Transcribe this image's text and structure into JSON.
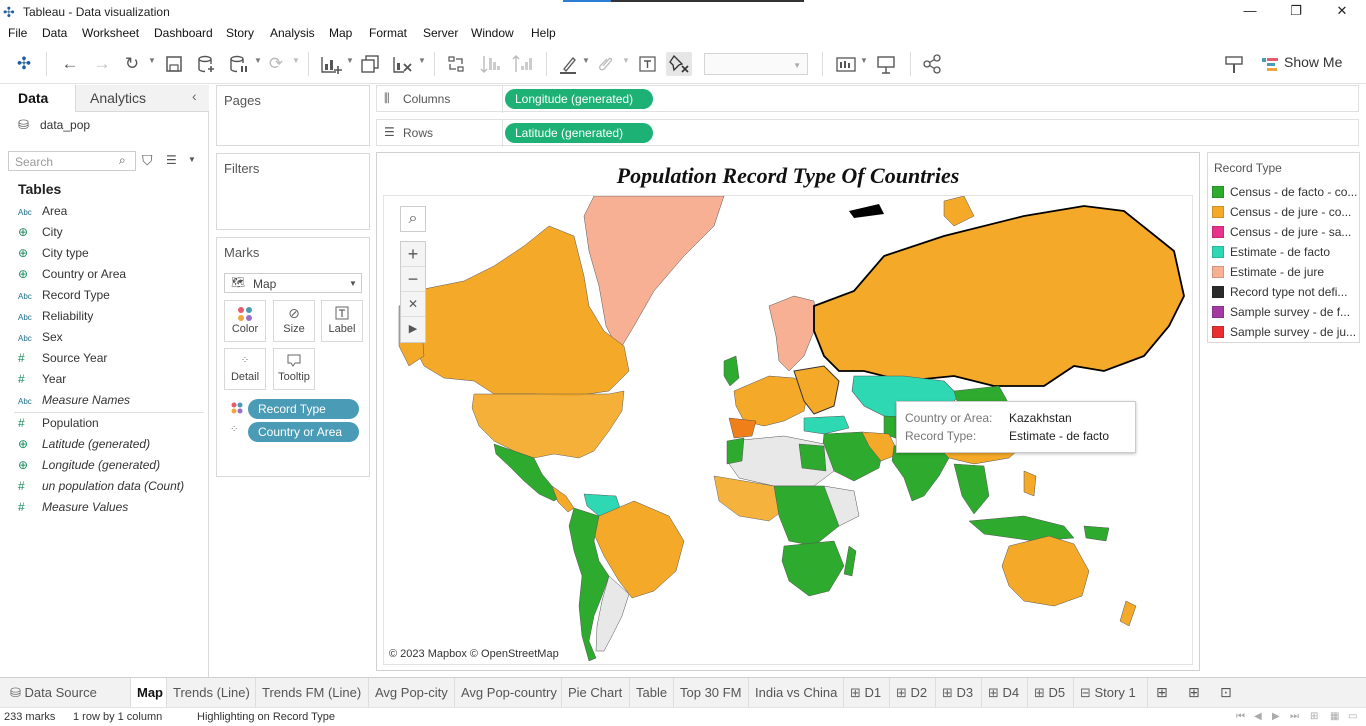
{
  "window": {
    "title": "Tableau - Data visualization",
    "controls": {
      "minimize": "—",
      "restore": "❐",
      "close": "✕"
    }
  },
  "menu": [
    "File",
    "Data",
    "Worksheet",
    "Dashboard",
    "Story",
    "Analysis",
    "Map",
    "Format",
    "Server",
    "Window",
    "Help"
  ],
  "toolbar": {
    "show_me": "Show Me"
  },
  "left_panel": {
    "tabs": {
      "data": "Data",
      "analytics": "Analytics"
    },
    "datasource": "data_pop",
    "search_placeholder": "Search",
    "tables_heading": "Tables",
    "dimensions": [
      {
        "type": "abc",
        "name": "Area"
      },
      {
        "type": "geo",
        "name": "City"
      },
      {
        "type": "geo",
        "name": "City type"
      },
      {
        "type": "geo",
        "name": "Country or Area"
      },
      {
        "type": "abc",
        "name": "Record Type"
      },
      {
        "type": "abc",
        "name": "Reliability"
      },
      {
        "type": "abc",
        "name": "Sex"
      },
      {
        "type": "num",
        "name": "Source Year"
      },
      {
        "type": "num",
        "name": "Year"
      },
      {
        "type": "abc",
        "name": "Measure Names",
        "italic": true
      }
    ],
    "measures": [
      {
        "type": "num",
        "name": "Population"
      },
      {
        "type": "geo",
        "name": "Latitude (generated)",
        "italic": true
      },
      {
        "type": "geo",
        "name": "Longitude (generated)",
        "italic": true
      },
      {
        "type": "num",
        "name": "un population data (Count)",
        "italic": true
      },
      {
        "type": "num",
        "name": "Measure Values",
        "italic": true
      }
    ]
  },
  "shelves": {
    "pages": "Pages",
    "filters": "Filters",
    "marks": "Marks",
    "mark_type": "Map",
    "mark_buttons": {
      "color": "Color",
      "size": "Size",
      "label": "Label",
      "detail": "Detail",
      "tooltip": "Tooltip"
    },
    "mark_pills": [
      "Record Type",
      "Country or Area"
    ],
    "columns_label": "Columns",
    "rows_label": "Rows",
    "columns_pill": "Longitude (generated)",
    "rows_pill": "Latitude (generated)"
  },
  "viz": {
    "title": "Population Record Type Of Countries",
    "credit": "© 2023 Mapbox © OpenStreetMap",
    "tooltip": {
      "k1": "Country or Area:",
      "v1": "Kazakhstan",
      "k2": "Record Type:",
      "v2": "Estimate - de facto"
    }
  },
  "legend": {
    "title": "Record Type",
    "items": [
      {
        "label": "Census - de facto - co...",
        "color": "#2eaa2e"
      },
      {
        "label": "Census - de jure - co...",
        "color": "#f4aa28"
      },
      {
        "label": "Census - de jure - sa...",
        "color": "#e8338a"
      },
      {
        "label": "Estimate - de facto",
        "color": "#2ed8b2"
      },
      {
        "label": "Estimate - de jure",
        "color": "#f7b093"
      },
      {
        "label": "Record type not defi...",
        "color": "#2b2b2b"
      },
      {
        "label": "Sample survey - de f...",
        "color": "#a33aa3"
      },
      {
        "label": "Sample survey - de ju...",
        "color": "#e83030"
      }
    ]
  },
  "sheet_tabs": {
    "datasource": "Data Source",
    "tabs": [
      "Map",
      "Trends (Line)",
      "Trends FM (Line)",
      "Avg Pop-city",
      "Avg Pop-country",
      "Pie Chart",
      "Table",
      "Top 30 FM",
      "India vs China",
      "D1",
      "D2",
      "D3",
      "D4",
      "D5",
      "Story 1"
    ]
  },
  "status": {
    "marks": "233 marks",
    "rowscols": "1 row by 1 column",
    "highlight": "Highlighting on Record Type"
  }
}
